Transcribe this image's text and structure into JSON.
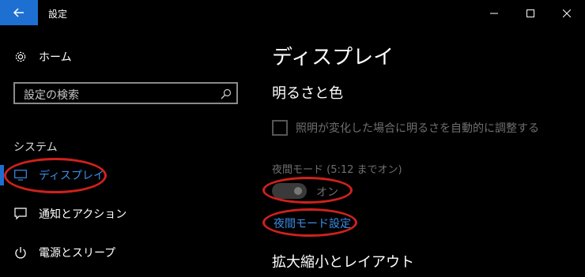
{
  "window": {
    "title": "設定"
  },
  "sidebar": {
    "home_label": "ホーム",
    "search_placeholder": "設定の検索",
    "section_label": "システム",
    "items": [
      {
        "label": "ディスプレイ",
        "icon": "monitor-icon",
        "selected": true
      },
      {
        "label": "通知とアクション",
        "icon": "message-icon",
        "selected": false
      },
      {
        "label": "電源とスリープ",
        "icon": "power-icon",
        "selected": false
      }
    ]
  },
  "main": {
    "title": "ディスプレイ",
    "section1": "明るさと色",
    "auto_brightness_label": "照明が変化した場合に明るさを自動的に調整する",
    "night_light_label": "夜間モード (5:12 までオン)",
    "toggle_state": "オン",
    "night_light_settings_link": "夜間モード設定",
    "section2": "拡大縮小とレイアウト"
  },
  "colors": {
    "accent": "#1e6fd2",
    "link": "#3b8ee8",
    "annotation": "#d0211c"
  }
}
